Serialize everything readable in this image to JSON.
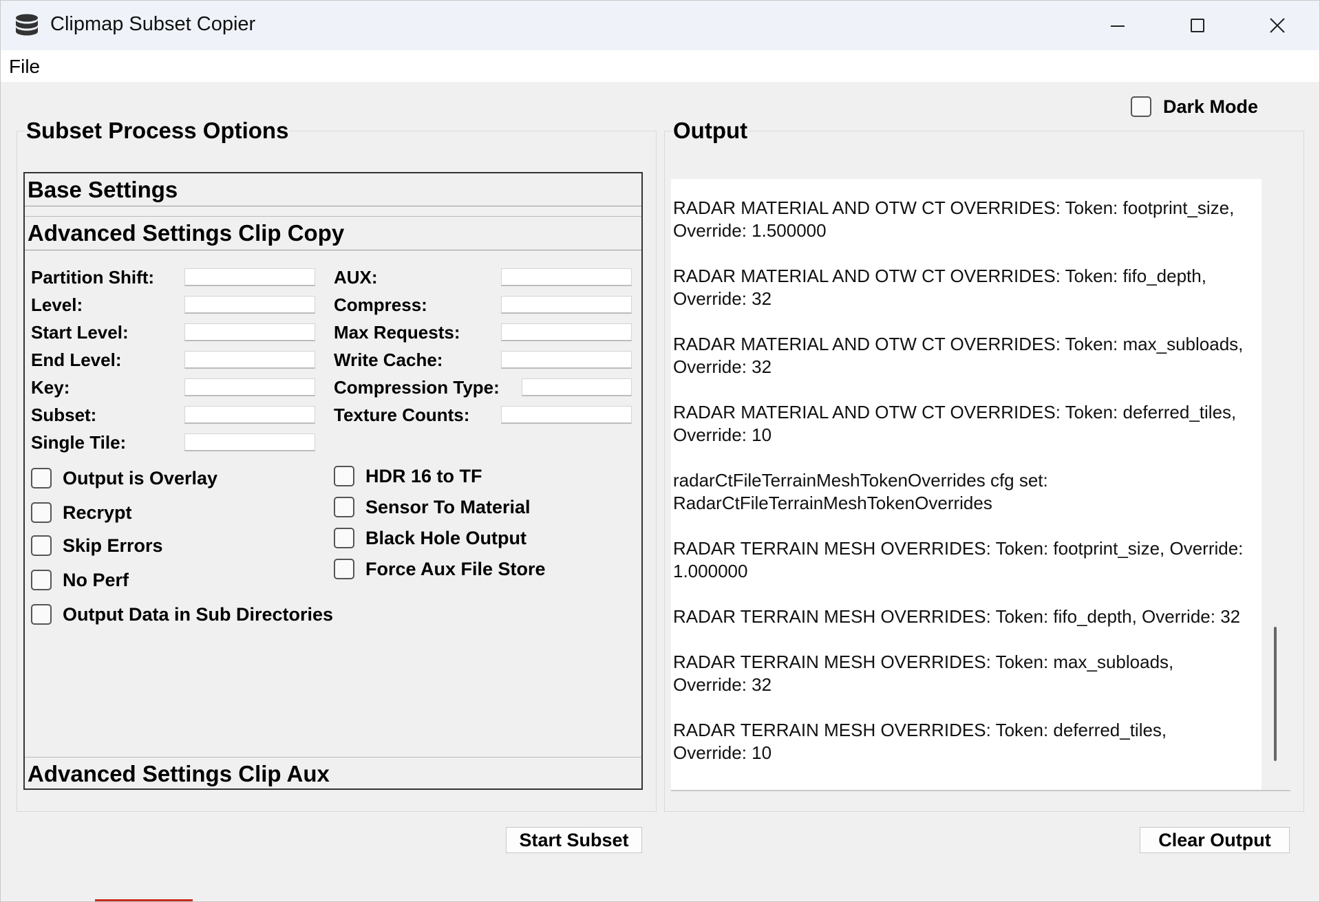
{
  "window": {
    "title": "Clipmap Subset Copier",
    "app_icon": "database-icon",
    "controls": [
      "minimize-icon",
      "maximize-icon",
      "close-icon"
    ]
  },
  "menu": {
    "items": [
      "File"
    ]
  },
  "dark_mode": {
    "label": "Dark Mode",
    "checked": false
  },
  "left": {
    "title": "Subset Process Options",
    "sections": {
      "base": "Base Settings",
      "clip_copy": "Advanced Settings Clip Copy",
      "clip_aux": "Advanced Settings Clip Aux"
    },
    "fields_left": [
      {
        "label": "Partition Shift:",
        "value": ""
      },
      {
        "label": "Level:",
        "value": ""
      },
      {
        "label": "Start Level:",
        "value": ""
      },
      {
        "label": "End Level:",
        "value": ""
      },
      {
        "label": "Key:",
        "value": ""
      },
      {
        "label": "Subset:",
        "value": ""
      },
      {
        "label": "Single Tile:",
        "value": ""
      }
    ],
    "fields_right": [
      {
        "label": "AUX:",
        "value": ""
      },
      {
        "label": "Compress:",
        "value": ""
      },
      {
        "label": "Max Requests:",
        "value": ""
      },
      {
        "label": "Write Cache:",
        "value": ""
      },
      {
        "label": "Compression Type:",
        "value": ""
      },
      {
        "label": "Texture Counts:",
        "value": ""
      }
    ],
    "checks_left": [
      {
        "label": "Output is Overlay",
        "checked": false
      },
      {
        "label": "Recrypt",
        "checked": false
      },
      {
        "label": "Skip Errors",
        "checked": false
      },
      {
        "label": "No Perf",
        "checked": false
      },
      {
        "label": "Output Data in Sub Directories",
        "checked": false
      }
    ],
    "checks_right": [
      {
        "label": "HDR 16 to TF",
        "checked": false
      },
      {
        "label": "Sensor To Material",
        "checked": false
      },
      {
        "label": "Black Hole Output",
        "checked": false
      },
      {
        "label": "Force Aux File Store",
        "checked": false
      }
    ],
    "start_button": "Start Subset"
  },
  "right": {
    "title": "Output",
    "lines": [
      "RADAR MATERIAL AND OTW CT OVERRIDES: Token: footprint_size, Override: 1.500000",
      "RADAR MATERIAL AND OTW CT OVERRIDES: Token: fifo_depth, Override: 32",
      "RADAR MATERIAL AND OTW CT OVERRIDES: Token: max_subloads, Override: 32",
      "RADAR MATERIAL AND OTW CT OVERRIDES: Token: deferred_tiles, Override: 10",
      "radarCtFileTerrainMeshTokenOverrides cfg set: RadarCtFileTerrainMeshTokenOverrides",
      "RADAR TERRAIN MESH OVERRIDES: Token: footprint_size, Override: 1.000000",
      "RADAR TERRAIN MESH OVERRIDES: Token: fifo_depth, Override: 32",
      "RADAR TERRAIN MESH OVERRIDES: Token: max_subloads, Override: 32",
      "RADAR TERRAIN MESH OVERRIDES: Token: deferred_tiles, Override: 10"
    ],
    "clear_button": "Clear Output"
  }
}
